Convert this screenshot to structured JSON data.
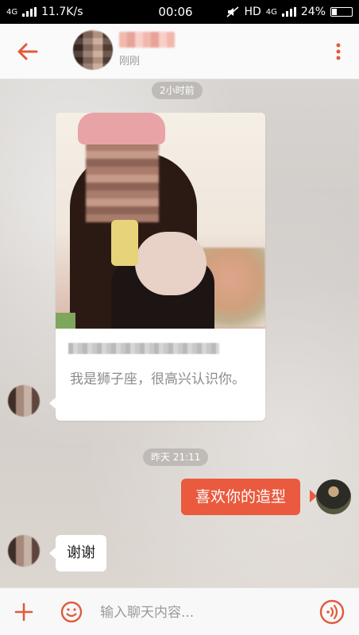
{
  "status_bar": {
    "network": "4G",
    "speed": "11.7K/s",
    "time": "00:06",
    "hd_label": "HD",
    "network_right": "4G",
    "battery": "24%"
  },
  "header": {
    "status": "刚刚"
  },
  "messages": {
    "time_1": "2小时前",
    "card_text": "我是狮子座，很高兴认识你。",
    "time_2": "昨天 21:11",
    "outgoing": "喜欢你的造型",
    "incoming": "谢谢"
  },
  "input_bar": {
    "placeholder": "输入聊天内容..."
  },
  "colors": {
    "accent": "#ea5a3e",
    "icon": "#e15a3e"
  }
}
